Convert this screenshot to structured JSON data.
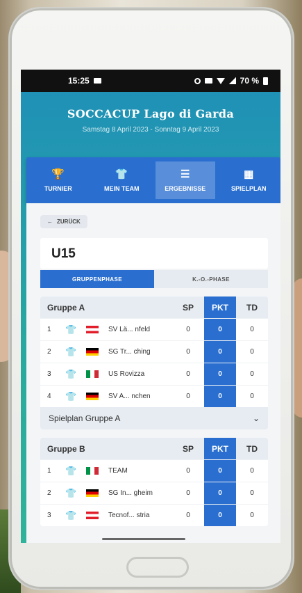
{
  "status": {
    "time": "15:25",
    "battery": "70 %"
  },
  "app": {
    "title": "SOCCACUP Lago di Garda",
    "dates": "Samstag 8 April 2023 - Sonntag 9 April 2023"
  },
  "nav": [
    {
      "label": "TURNIER",
      "icon": "trophy-icon",
      "glyph": "🏆"
    },
    {
      "label": "MEIN TEAM",
      "icon": "shirt-icon",
      "glyph": "👕"
    },
    {
      "label": "ERGEBNISSE",
      "icon": "list-icon",
      "glyph": "☰"
    },
    {
      "label": "SPIELPLAN",
      "icon": "calendar-icon",
      "glyph": "▦"
    }
  ],
  "back": {
    "label": "ZURÜCK"
  },
  "age": "U15",
  "phases": {
    "group": "GRUPPENPHASE",
    "ko": "K.-O.-PHASE"
  },
  "columns": {
    "sp": "SP",
    "pkt": "PKT",
    "td": "TD"
  },
  "groups": [
    {
      "name": "Gruppe A",
      "footer": "Spielplan Gruppe A",
      "rows": [
        {
          "pos": "1",
          "flag": "at",
          "team": "SV Lä... nfeld",
          "sp": "0",
          "pkt": "0",
          "td": "0"
        },
        {
          "pos": "2",
          "flag": "de",
          "team": "SG Tr... ching",
          "sp": "0",
          "pkt": "0",
          "td": "0"
        },
        {
          "pos": "3",
          "flag": "it",
          "team": "US Rovizza",
          "sp": "0",
          "pkt": "0",
          "td": "0"
        },
        {
          "pos": "4",
          "flag": "de",
          "team": "SV A... nchen",
          "sp": "0",
          "pkt": "0",
          "td": "0"
        }
      ]
    },
    {
      "name": "Gruppe B",
      "rows": [
        {
          "pos": "1",
          "flag": "it",
          "team": "TEAM",
          "sp": "0",
          "pkt": "0",
          "td": "0"
        },
        {
          "pos": "2",
          "flag": "de",
          "team": "SG In... gheim",
          "sp": "0",
          "pkt": "0",
          "td": "0"
        },
        {
          "pos": "3",
          "flag": "at",
          "team": "Tecnof... stria",
          "sp": "0",
          "pkt": "0",
          "td": "0"
        }
      ]
    }
  ]
}
